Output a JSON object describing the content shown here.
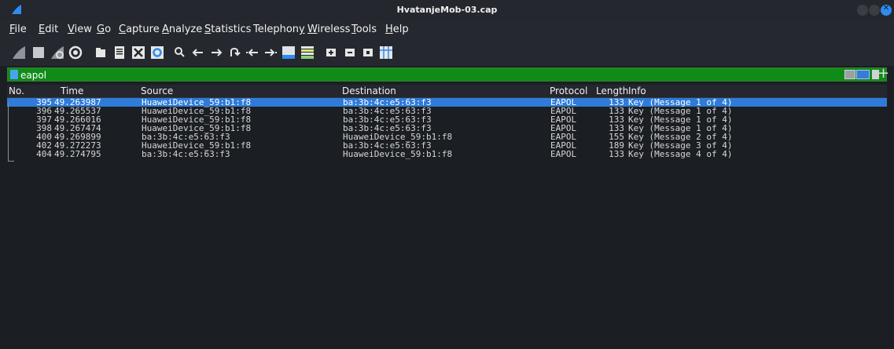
{
  "window": {
    "title": "HvatanjeMob-03.cap",
    "accent": "#2d8cf0"
  },
  "menu": [
    {
      "mnemonic": "F",
      "rest": "ile"
    },
    {
      "mnemonic": "E",
      "rest": "dit"
    },
    {
      "mnemonic": "V",
      "rest": "iew"
    },
    {
      "mnemonic": "G",
      "rest": "o"
    },
    {
      "mnemonic": "C",
      "rest": "apture"
    },
    {
      "mnemonic": "A",
      "rest": "nalyze"
    },
    {
      "mnemonic": "S",
      "rest": "tatistics"
    },
    {
      "mnemonic": "",
      "rest": "Telephon",
      "suffix_mnemonic": "y"
    },
    {
      "mnemonic": "W",
      "rest": "ireless"
    },
    {
      "mnemonic": "T",
      "rest": "ools"
    },
    {
      "mnemonic": "H",
      "rest": "elp"
    }
  ],
  "toolbar": {
    "icons": [
      "start-capture-icon",
      "stop-capture-icon",
      "restart-capture-icon",
      "capture-options-icon",
      "open-file-icon",
      "save-file-icon",
      "close-file-icon",
      "reload-file-icon",
      "find-packet-icon",
      "go-back-icon",
      "go-forward-icon",
      "go-to-packet-icon",
      "go-first-icon",
      "go-last-icon",
      "auto-scroll-icon",
      "colorize-icon",
      "zoom-in-icon",
      "zoom-out-icon",
      "normal-size-icon",
      "resize-columns-icon"
    ]
  },
  "filter": {
    "value": "eapol",
    "bg_color": "#0f8c18"
  },
  "columns": {
    "no": "No.",
    "time": "Time",
    "source": "Source",
    "destination": "Destination",
    "protocol": "Protocol",
    "length": "Length",
    "info": "Info"
  },
  "packets": [
    {
      "no": "395",
      "time": "49.263987",
      "source": "HuaweiDevice_59:b1:f8",
      "destination": "ba:3b:4c:e5:63:f3",
      "protocol": "EAPOL",
      "length": "133",
      "info": "Key (Message 1 of 4)",
      "selected": true
    },
    {
      "no": "396",
      "time": "49.265537",
      "source": "HuaweiDevice_59:b1:f8",
      "destination": "ba:3b:4c:e5:63:f3",
      "protocol": "EAPOL",
      "length": "133",
      "info": "Key (Message 1 of 4)"
    },
    {
      "no": "397",
      "time": "49.266016",
      "source": "HuaweiDevice_59:b1:f8",
      "destination": "ba:3b:4c:e5:63:f3",
      "protocol": "EAPOL",
      "length": "133",
      "info": "Key (Message 1 of 4)"
    },
    {
      "no": "398",
      "time": "49.267474",
      "source": "HuaweiDevice_59:b1:f8",
      "destination": "ba:3b:4c:e5:63:f3",
      "protocol": "EAPOL",
      "length": "133",
      "info": "Key (Message 1 of 4)"
    },
    {
      "no": "400",
      "time": "49.269899",
      "source": "ba:3b:4c:e5:63:f3",
      "destination": "HuaweiDevice_59:b1:f8",
      "protocol": "EAPOL",
      "length": "155",
      "info": "Key (Message 2 of 4)"
    },
    {
      "no": "402",
      "time": "49.272273",
      "source": "HuaweiDevice_59:b1:f8",
      "destination": "ba:3b:4c:e5:63:f3",
      "protocol": "EAPOL",
      "length": "189",
      "info": "Key (Message 3 of 4)"
    },
    {
      "no": "404",
      "time": "49.274795",
      "source": "ba:3b:4c:e5:63:f3",
      "destination": "HuaweiDevice_59:b1:f8",
      "protocol": "EAPOL",
      "length": "133",
      "info": "Key (Message 4 of 4)"
    }
  ]
}
